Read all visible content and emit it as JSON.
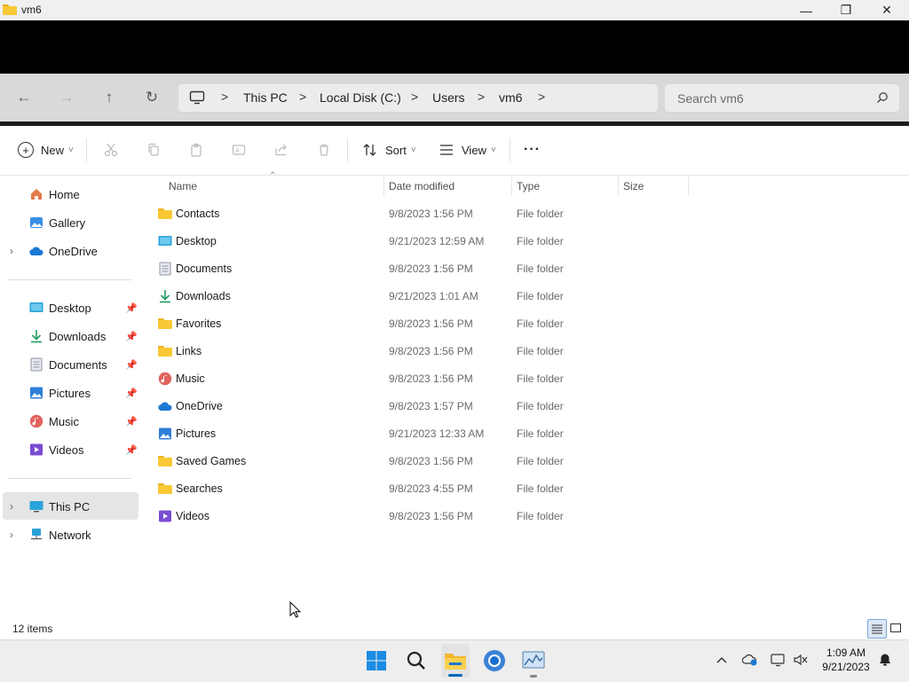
{
  "window": {
    "title": "vm6",
    "minimize": "—",
    "maximize": "❐",
    "close": "✕"
  },
  "nav": {
    "back": "←",
    "forward": "→",
    "up": "↑",
    "refresh": "↻"
  },
  "breadcrumbs": [
    "This PC",
    "Local Disk (C:)",
    "Users",
    "vm6"
  ],
  "breadcrumb_sep": ">",
  "search": {
    "placeholder": "Search vm6"
  },
  "toolbar": {
    "new_label": "New",
    "sort_label": "Sort",
    "view_label": "View",
    "more_label": "···",
    "caret": "˅"
  },
  "sidebar": {
    "top": [
      {
        "label": "Home",
        "icon": "home-icon"
      },
      {
        "label": "Gallery",
        "icon": "gallery-icon"
      },
      {
        "label": "OneDrive",
        "icon": "cloud-icon"
      }
    ],
    "quick_access": [
      {
        "label": "Desktop",
        "icon": "desktop-icon"
      },
      {
        "label": "Downloads",
        "icon": "download-icon"
      },
      {
        "label": "Documents",
        "icon": "documents-icon"
      },
      {
        "label": "Pictures",
        "icon": "pictures-icon"
      },
      {
        "label": "Music",
        "icon": "music-icon"
      },
      {
        "label": "Videos",
        "icon": "videos-icon"
      }
    ],
    "devices": [
      {
        "label": "This PC",
        "icon": "pc-icon"
      },
      {
        "label": "Network",
        "icon": "network-icon"
      }
    ]
  },
  "columns": {
    "name": "Name",
    "date": "Date modified",
    "type": "Type",
    "size": "Size"
  },
  "files": [
    {
      "name": "Contacts",
      "date": "9/8/2023 1:56 PM",
      "type": "File folder",
      "icon": "folder-icon"
    },
    {
      "name": "Desktop",
      "date": "9/21/2023 12:59 AM",
      "type": "File folder",
      "icon": "desktop-icon"
    },
    {
      "name": "Documents",
      "date": "9/8/2023 1:56 PM",
      "type": "File folder",
      "icon": "documents-icon"
    },
    {
      "name": "Downloads",
      "date": "9/21/2023 1:01 AM",
      "type": "File folder",
      "icon": "download-icon"
    },
    {
      "name": "Favorites",
      "date": "9/8/2023 1:56 PM",
      "type": "File folder",
      "icon": "folder-icon"
    },
    {
      "name": "Links",
      "date": "9/8/2023 1:56 PM",
      "type": "File folder",
      "icon": "folder-icon"
    },
    {
      "name": "Music",
      "date": "9/8/2023 1:56 PM",
      "type": "File folder",
      "icon": "music-icon"
    },
    {
      "name": "OneDrive",
      "date": "9/8/2023 1:57 PM",
      "type": "File folder",
      "icon": "cloud-icon"
    },
    {
      "name": "Pictures",
      "date": "9/21/2023 12:33 AM",
      "type": "File folder",
      "icon": "pictures-icon"
    },
    {
      "name": "Saved Games",
      "date": "9/8/2023 1:56 PM",
      "type": "File folder",
      "icon": "folder-icon"
    },
    {
      "name": "Searches",
      "date": "9/8/2023 4:55 PM",
      "type": "File folder",
      "icon": "folder-icon"
    },
    {
      "name": "Videos",
      "date": "9/8/2023 1:56 PM",
      "type": "File folder",
      "icon": "videos-icon"
    }
  ],
  "status": {
    "items": "12 items"
  },
  "clock": {
    "time": "1:09 AM",
    "date": "9/21/2023"
  },
  "colors": {
    "accent": "#0067c0",
    "folder": "#f8c935",
    "selection": "#e5e5e5"
  }
}
